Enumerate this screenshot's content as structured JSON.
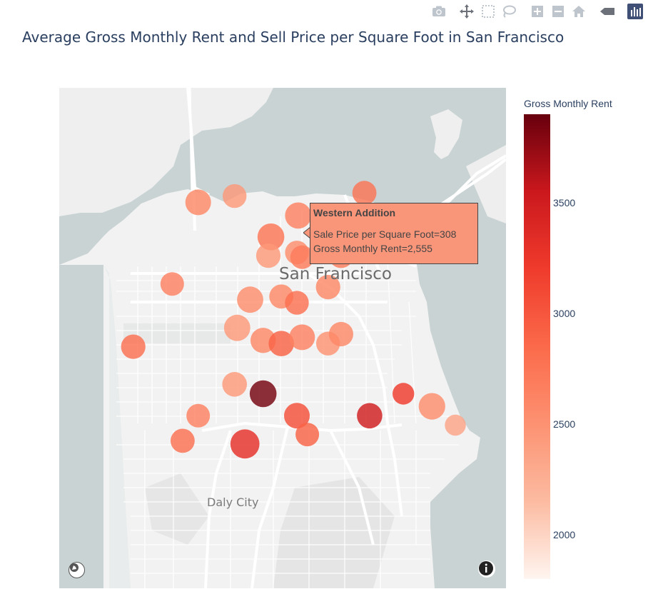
{
  "figure": {
    "title": "Average Gross Monthly Rent and Sell Price per Square Foot in San Francisco"
  },
  "modebar": {
    "buttons": [
      {
        "name": "camera-icon"
      },
      {
        "name": "pan-icon"
      },
      {
        "name": "box-select-icon"
      },
      {
        "name": "lasso-select-icon"
      },
      {
        "name": "zoom-in-icon"
      },
      {
        "name": "zoom-out-icon"
      },
      {
        "name": "home-icon"
      },
      {
        "name": "hover-toggle-icon"
      },
      {
        "name": "plotly-logo-icon"
      }
    ]
  },
  "map": {
    "labels": {
      "city": "San Francisco",
      "secondary_city": "Daly City"
    },
    "colors": {
      "water": "#c9d3d3",
      "land": "#f2f2f2",
      "roads": "#ffffff"
    }
  },
  "colorbar": {
    "title": "Gross Monthly Rent",
    "ticks": [
      "2000",
      "2500",
      "3000",
      "3500"
    ],
    "range": [
      1800,
      3900
    ],
    "colorscale": [
      "#fff5f0",
      "#fcbba1",
      "#fc9272",
      "#fb6a4a",
      "#ef3b2c",
      "#cb181d",
      "#67000d"
    ]
  },
  "hover": {
    "neighborhood": "Western Addition",
    "sale_price_line": "Sale Price per Square Foot=308",
    "rent_line": "Gross Monthly Rent=2,555"
  },
  "chart_data": {
    "type": "scatter",
    "title": "Average Gross Monthly Rent and Sell Price per Square Foot in San Francisco",
    "color_variable": "Gross Monthly Rent",
    "size_variable": "Sale Price per Square Foot",
    "points": [
      {
        "lon": -122.47,
        "lat": 37.801,
        "rent": 2600,
        "size": 380
      },
      {
        "lon": -122.456,
        "lat": 37.803,
        "rent": 2450,
        "size": 310
      },
      {
        "lon": -122.406,
        "lat": 37.804,
        "rent": 2750,
        "size": 320
      },
      {
        "lon": -122.4315,
        "lat": 37.7968,
        "rent": 2650,
        "size": 400
      },
      {
        "lon": -122.442,
        "lat": 37.79,
        "rent": 2750,
        "size": 420
      },
      {
        "lon": -122.443,
        "lat": 37.784,
        "rent": 2450,
        "size": 330
      },
      {
        "lon": -122.432,
        "lat": 37.785,
        "rent": 2555,
        "size": 308
      },
      {
        "lon": -122.43,
        "lat": 37.7835,
        "rent": 2700,
        "size": 300
      },
      {
        "lon": -122.415,
        "lat": 37.784,
        "rent": 2700,
        "size": 340
      },
      {
        "lon": -122.401,
        "lat": 37.786,
        "rent": 2450,
        "size": 350
      },
      {
        "lon": -122.48,
        "lat": 37.775,
        "rent": 2650,
        "size": 300
      },
      {
        "lon": -122.45,
        "lat": 37.77,
        "rent": 2550,
        "size": 400
      },
      {
        "lon": -122.438,
        "lat": 37.771,
        "rent": 2600,
        "size": 320
      },
      {
        "lon": -122.432,
        "lat": 37.769,
        "rent": 2800,
        "size": 310
      },
      {
        "lon": -122.42,
        "lat": 37.774,
        "rent": 2600,
        "size": 330
      },
      {
        "lon": -122.455,
        "lat": 37.761,
        "rent": 2450,
        "size": 400
      },
      {
        "lon": -122.445,
        "lat": 37.757,
        "rent": 2600,
        "size": 360
      },
      {
        "lon": -122.438,
        "lat": 37.756,
        "rent": 2900,
        "size": 370
      },
      {
        "lon": -122.43,
        "lat": 37.758,
        "rent": 2650,
        "size": 380
      },
      {
        "lon": -122.42,
        "lat": 37.756,
        "rent": 2500,
        "size": 310
      },
      {
        "lon": -122.415,
        "lat": 37.759,
        "rent": 2600,
        "size": 330
      },
      {
        "lon": -122.495,
        "lat": 37.755,
        "rent": 2800,
        "size": 330
      },
      {
        "lon": -122.456,
        "lat": 37.743,
        "rent": 2450,
        "size": 340
      },
      {
        "lon": -122.445,
        "lat": 37.74,
        "rent": 3850,
        "size": 420
      },
      {
        "lon": -122.47,
        "lat": 37.733,
        "rent": 2650,
        "size": 300
      },
      {
        "lon": -122.432,
        "lat": 37.733,
        "rent": 3050,
        "size": 380
      },
      {
        "lon": -122.404,
        "lat": 37.733,
        "rent": 3500,
        "size": 370
      },
      {
        "lon": -122.391,
        "lat": 37.74,
        "rent": 3200,
        "size": 240
      },
      {
        "lon": -122.38,
        "lat": 37.736,
        "rent": 2550,
        "size": 410
      },
      {
        "lon": -122.476,
        "lat": 37.725,
        "rent": 2800,
        "size": 320
      },
      {
        "lon": -122.452,
        "lat": 37.724,
        "rent": 3300,
        "size": 520
      },
      {
        "lon": -122.428,
        "lat": 37.727,
        "rent": 2900,
        "size": 300
      },
      {
        "lon": -122.371,
        "lat": 37.73,
        "rent": 2350,
        "size": 220
      }
    ]
  }
}
